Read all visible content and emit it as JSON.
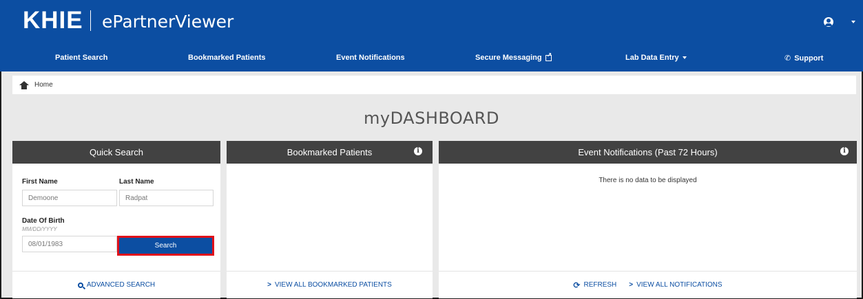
{
  "header": {
    "logo": "KHIE",
    "app_title": "ePartnerViewer"
  },
  "nav": {
    "patient_search": "Patient Search",
    "bookmarked_patients": "Bookmarked Patients",
    "event_notifications": "Event Notifications",
    "secure_messaging": "Secure Messaging",
    "lab_data_entry": "Lab Data Entry",
    "support": "Support"
  },
  "breadcrumb": {
    "home": "Home"
  },
  "dashboard": {
    "title": "myDASHBOARD"
  },
  "quick_search": {
    "title": "Quick Search",
    "first_name_label": "First Name",
    "first_name_value": "Demoone",
    "last_name_label": "Last Name",
    "last_name_value": "Radpat",
    "dob_label": "Date Of Birth",
    "dob_hint": "MM/DD/YYYY",
    "dob_value": "08/01/1983",
    "search_button": "Search",
    "advanced_search": "ADVANCED SEARCH"
  },
  "bookmarked": {
    "title": "Bookmarked Patients",
    "view_all": "VIEW ALL BOOKMARKED PATIENTS"
  },
  "events": {
    "title": "Event Notifications (Past 72 Hours)",
    "empty_message": "There is no data to be displayed",
    "refresh": "REFRESH",
    "view_all": "VIEW ALL NOTIFICATIONS"
  },
  "colors": {
    "brand_blue": "#0c4ea2",
    "panel_header": "#424242",
    "highlight_red": "#e0101a"
  }
}
